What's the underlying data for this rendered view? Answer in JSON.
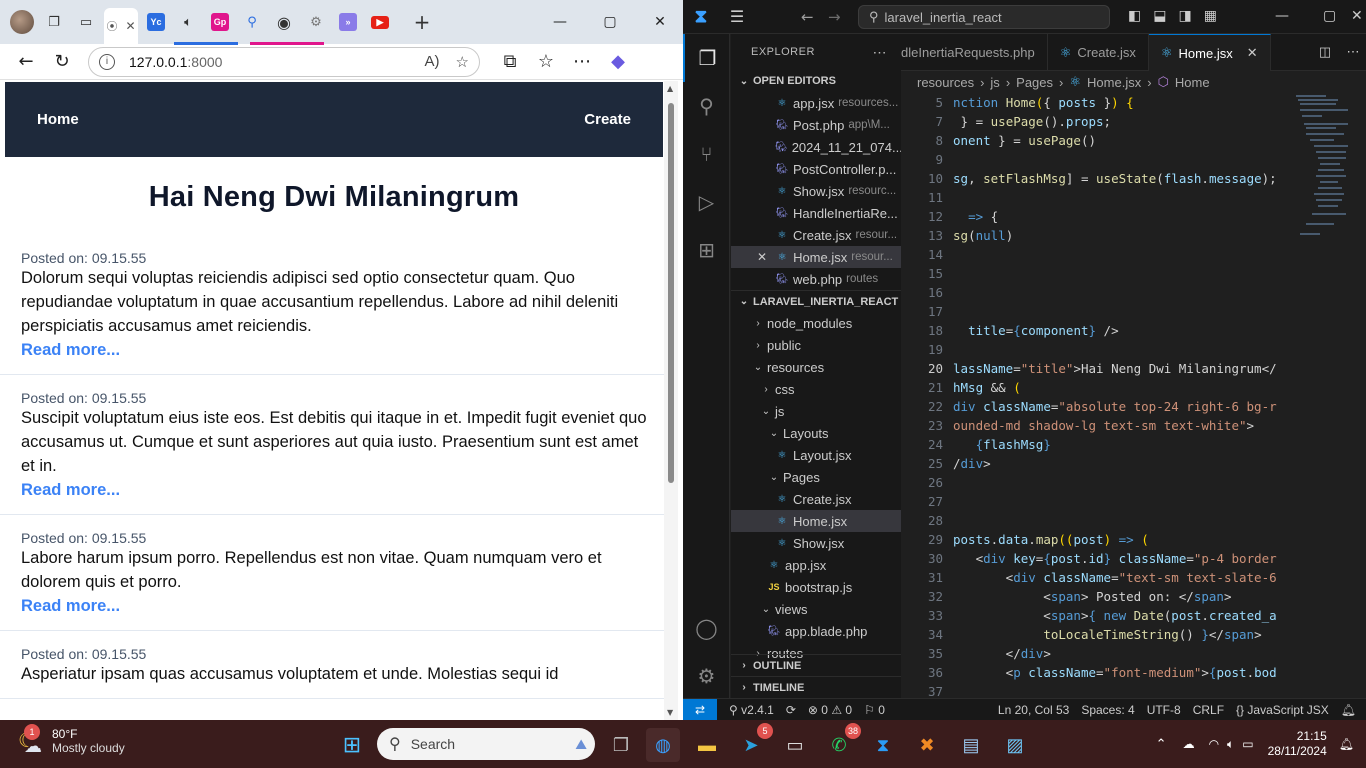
{
  "browser": {
    "tabs": [
      {
        "label": "Yc",
        "color": "#2b6de0"
      },
      {
        "label": "Gp",
        "color": "#e0168c"
      }
    ],
    "address": {
      "host": "127.0.0.1",
      "port": ":8000"
    },
    "window_controls": [
      "minimize",
      "maximize",
      "close"
    ]
  },
  "site": {
    "nav": {
      "home": "Home",
      "create": "Create"
    },
    "title": "Hai Neng Dwi Milaningrum",
    "posts": [
      {
        "date_label": "Posted on: 09.15.55",
        "body": "Dolorum sequi voluptas reiciendis adipisci sed optio consectetur quam. Quo repudiandae voluptatum in quae accusantium repellendus. Labore ad nihil deleniti perspiciatis accusamus amet reiciendis.",
        "read_more": "Read more..."
      },
      {
        "date_label": "Posted on: 09.15.55",
        "body": "Suscipit voluptatum eius iste eos. Est debitis qui itaque in et. Impedit fugit eveniet quo accusamus ut. Cumque et sunt asperiores aut quia iusto. Praesentium sunt est amet et in.",
        "read_more": "Read more..."
      },
      {
        "date_label": "Posted on: 09.15.55",
        "body": "Labore harum ipsum porro. Repellendus est non vitae. Quam numquam vero et dolorem quis et porro.",
        "read_more": "Read more..."
      },
      {
        "date_label": "Posted on: 09.15.55",
        "body": "Asperiatur ipsam quas accusamus voluptatem et unde. Molestias sequi id",
        "read_more": ""
      }
    ]
  },
  "vscode": {
    "command_center": "laravel_inertia_react",
    "explorer_label": "EXPLORER",
    "open_editors_label": "OPEN EDITORS",
    "open_editors": [
      {
        "name": "app.jsx",
        "desc": "resources...",
        "icon": "react"
      },
      {
        "name": "Post.php",
        "desc": "app\\M...",
        "icon": "php"
      },
      {
        "name": "2024_11_21_074...",
        "desc": "",
        "icon": "php"
      },
      {
        "name": "PostController.p...",
        "desc": "",
        "icon": "php"
      },
      {
        "name": "Show.jsx",
        "desc": "resourc...",
        "icon": "react"
      },
      {
        "name": "HandleInertiaRe...",
        "desc": "",
        "icon": "php"
      },
      {
        "name": "Create.jsx",
        "desc": "resour...",
        "icon": "react"
      },
      {
        "name": "Home.jsx",
        "desc": "resour...",
        "icon": "react"
      },
      {
        "name": "web.php",
        "desc": "routes",
        "icon": "php"
      }
    ],
    "project_label": "LARAVEL_INERTIA_REACT",
    "tree": [
      {
        "name": "node_modules",
        "type": "folder-closed",
        "depth": 1
      },
      {
        "name": "public",
        "type": "folder-closed",
        "depth": 1
      },
      {
        "name": "resources",
        "type": "folder-open",
        "depth": 1
      },
      {
        "name": "css",
        "type": "folder-closed",
        "depth": 2
      },
      {
        "name": "js",
        "type": "folder-open",
        "depth": 2
      },
      {
        "name": "Layouts",
        "type": "folder-open",
        "depth": 3
      },
      {
        "name": "Layout.jsx",
        "type": "react",
        "depth": 4
      },
      {
        "name": "Pages",
        "type": "folder-open",
        "depth": 3
      },
      {
        "name": "Create.jsx",
        "type": "react",
        "depth": 4
      },
      {
        "name": "Home.jsx",
        "type": "react",
        "depth": 4
      },
      {
        "name": "Show.jsx",
        "type": "react",
        "depth": 4
      },
      {
        "name": "app.jsx",
        "type": "react",
        "depth": 3
      },
      {
        "name": "bootstrap.js",
        "type": "js",
        "depth": 3
      },
      {
        "name": "views",
        "type": "folder-open",
        "depth": 2
      },
      {
        "name": "app.blade.php",
        "type": "php",
        "depth": 3
      },
      {
        "name": "routes",
        "type": "folder-closed",
        "depth": 1
      }
    ],
    "outline_label": "OUTLINE",
    "timeline_label": "TIMELINE",
    "editor_tabs": [
      {
        "label": "dleInertiaRequests.php",
        "icon": "php"
      },
      {
        "label": "Create.jsx",
        "icon": "react"
      },
      {
        "label": "Home.jsx",
        "icon": "react"
      }
    ],
    "breadcrumbs": [
      "resources",
      "js",
      "Pages",
      "Home.jsx",
      "Home"
    ],
    "code_lines": [
      {
        "n": "5",
        "html": "<span class='kw'>nction</span> <span class='fn'>Home</span><span class='br'>(</span><span class='pl'>{</span> <span class='vr'>posts</span> <span class='pl'>}</span><span class='br'>)</span> <span class='br'>{</span>"
      },
      {
        "n": "7",
        "html": "<span class='pl'> } = </span><span class='fn'>usePage</span><span class='pl'>().</span><span class='vr'>props</span><span class='pl'>;</span>"
      },
      {
        "n": "8",
        "html": "<span class='vr'>onent</span><span class='pl'> } = </span><span class='fn'>usePage</span><span class='pl'>()</span>"
      },
      {
        "n": "9",
        "html": ""
      },
      {
        "n": "10",
        "html": "<span class='vr'>sg</span><span class='pl'>, </span><span class='fn'>setFlashMsg</span><span class='pl'>] = </span><span class='fn'>useState</span><span class='pl'>(</span><span class='vr'>flash</span><span class='pl'>.</span><span class='vr'>message</span><span class='pl'>);</span>"
      },
      {
        "n": "11",
        "html": ""
      },
      {
        "n": "12",
        "html": "<span class='pl'>  </span><span class='kw'>=&gt;</span><span class='pl'> {</span>"
      },
      {
        "n": "13",
        "html": "<span class='fn'>sg</span><span class='pl'>(</span><span class='kw'>null</span><span class='pl'>)</span>"
      },
      {
        "n": "14",
        "html": ""
      },
      {
        "n": "15",
        "html": ""
      },
      {
        "n": "16",
        "html": ""
      },
      {
        "n": "17",
        "html": ""
      },
      {
        "n": "18",
        "html": "<span class='pl'>  </span><span class='at'>title</span><span class='pl'>=</span><span class='kw'>{</span><span class='vr'>component</span><span class='kw'>}</span><span class='pl'> /&gt;</span>"
      },
      {
        "n": "19",
        "html": ""
      },
      {
        "n": "20",
        "html": "<span class='at'>lassName</span><span class='pl'>=</span><span class='st'>\"title\"</span><span class='pl'>&gt;Hai Neng Dwi Milaningrum&lt;/</span>"
      },
      {
        "n": "21",
        "html": "<span class='vr'>hMsg</span><span class='pl'> &amp;&amp; </span><span class='br'>(</span>"
      },
      {
        "n": "22",
        "html": "<span class='tg'>div</span> <span class='at'>className</span><span class='pl'>=</span><span class='st'>\"absolute top-24 right-6 bg-r</span>"
      },
      {
        "n": "23",
        "html": "<span class='st'>ounded-md shadow-lg text-sm text-white\"</span><span class='pl'>&gt;</span>"
      },
      {
        "n": "24",
        "html": "<span class='pl'>   </span><span class='kw'>{</span><span class='vr'>flashMsg</span><span class='kw'>}</span>"
      },
      {
        "n": "25",
        "html": "<span class='pl'>/</span><span class='tg'>div</span><span class='pl'>&gt;</span>"
      },
      {
        "n": "26",
        "html": ""
      },
      {
        "n": "27",
        "html": ""
      },
      {
        "n": "28",
        "html": ""
      },
      {
        "n": "29",
        "html": "<span class='vr'>posts</span><span class='pl'>.</span><span class='vr'>data</span><span class='pl'>.</span><span class='fn'>map</span><span class='br'>((</span><span class='vr'>post</span><span class='br'>)</span> <span class='kw'>=&gt;</span> <span class='br'>(</span>"
      },
      {
        "n": "30",
        "html": "<span class='pl'>   &lt;</span><span class='tg'>div</span> <span class='at'>key</span><span class='pl'>=</span><span class='kw'>{</span><span class='vr'>post</span><span class='pl'>.</span><span class='vr'>id</span><span class='kw'>}</span> <span class='at'>className</span><span class='pl'>=</span><span class='st'>\"p-4 border</span>"
      },
      {
        "n": "31",
        "html": "<span class='pl'>       &lt;</span><span class='tg'>div</span> <span class='at'>className</span><span class='pl'>=</span><span class='st'>\"text-sm text-slate-6</span>"
      },
      {
        "n": "32",
        "html": "<span class='pl'>            &lt;</span><span class='tg'>span</span><span class='pl'>&gt; Posted on: &lt;/</span><span class='tg'>span</span><span class='pl'>&gt;</span>"
      },
      {
        "n": "33",
        "html": "<span class='pl'>            &lt;</span><span class='tg'>span</span><span class='pl'>&gt;</span><span class='kw'>{</span> <span class='kw'>new</span> <span class='fn'>Date</span><span class='pl'>(</span><span class='vr'>post</span><span class='pl'>.</span><span class='vr'>created_a</span>"
      },
      {
        "n": "34",
        "html": "<span class='pl'>            </span><span class='fn'>toLocaleTimeString</span><span class='pl'>() </span><span class='kw'>}</span><span class='pl'>&lt;/</span><span class='tg'>span</span><span class='pl'>&gt;</span>"
      },
      {
        "n": "35",
        "html": "<span class='pl'>       &lt;/</span><span class='tg'>div</span><span class='pl'>&gt;</span>"
      },
      {
        "n": "36",
        "html": "<span class='pl'>       &lt;</span><span class='tg'>p</span> <span class='at'>className</span><span class='pl'>=</span><span class='st'>\"font-medium\"</span><span class='pl'>&gt;</span><span class='kw'>{</span><span class='vr'>post</span><span class='pl'>.</span><span class='vr'>bod</span>"
      },
      {
        "n": "37",
        "html": ""
      }
    ],
    "current_line": "20",
    "status": {
      "version": "v2.4.1",
      "problems_errors": "0",
      "problems_warnings": "0",
      "ports": "0",
      "position": "Ln 20, Col 53",
      "spaces": "Spaces: 4",
      "encoding": "UTF-8",
      "eol": "CRLF",
      "language": "JavaScript JSX"
    }
  },
  "taskbar": {
    "weather_temp": "80°F",
    "weather_cond": "Mostly cloudy",
    "weather_badge": "1",
    "search_placeholder": "Search",
    "telegram_badge": "5",
    "whatsapp_badge": "38",
    "time": "21:15",
    "date": "28/11/2024"
  }
}
